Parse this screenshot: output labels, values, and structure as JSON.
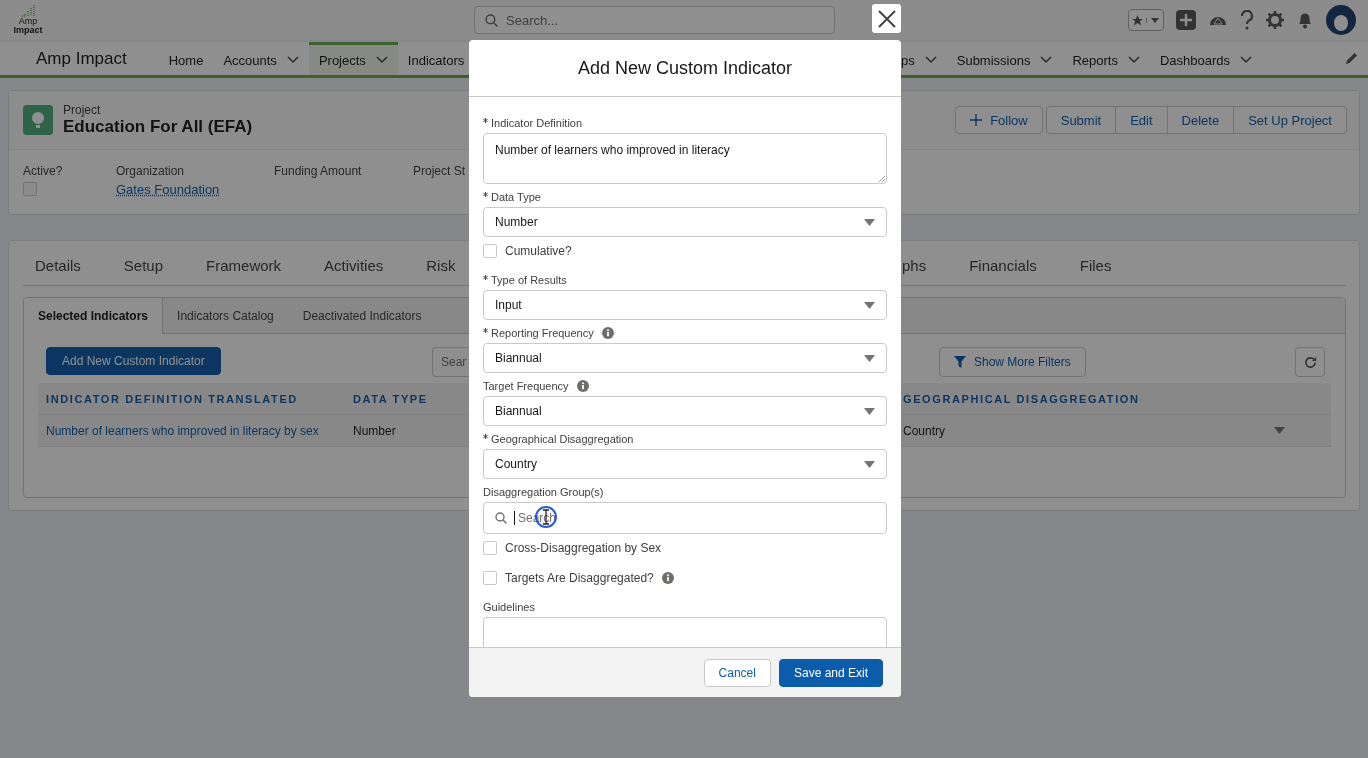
{
  "header": {
    "logo_lines": [
      "Amp",
      "Impact"
    ],
    "search": {
      "placeholder": "Search..."
    }
  },
  "nav": {
    "app_name": "Amp Impact",
    "items_left": [
      {
        "label": "Home",
        "menu": false,
        "selected": false
      },
      {
        "label": "Accounts",
        "menu": true,
        "selected": false
      },
      {
        "label": "Projects",
        "menu": true,
        "selected": true
      },
      {
        "label": "Indicators",
        "menu": false,
        "selected": false
      }
    ],
    "items_right": [
      {
        "label": "ps",
        "menu": true,
        "selected": false
      },
      {
        "label": "Submissions",
        "menu": true,
        "selected": false
      },
      {
        "label": "Reports",
        "menu": true,
        "selected": false
      },
      {
        "label": "Dashboards",
        "menu": true,
        "selected": false
      }
    ]
  },
  "record": {
    "type": "Project",
    "title": "Education For All (EFA)",
    "follow": "Follow",
    "actions": [
      "Submit",
      "Edit",
      "Delete",
      "Set Up Project"
    ],
    "fields": [
      {
        "label": "Active?",
        "kind": "checkbox",
        "checked": false
      },
      {
        "label": "Organization",
        "kind": "link",
        "value": "Gates Foundation"
      },
      {
        "label": "Funding Amount",
        "kind": "text"
      },
      {
        "label": "Project St",
        "kind": "text"
      }
    ]
  },
  "tabs_left": [
    {
      "label": "Details",
      "selected": false
    },
    {
      "label": "Setup",
      "selected": false
    },
    {
      "label": "Framework",
      "selected": false
    },
    {
      "label": "Activities",
      "selected": false
    },
    {
      "label": "Risk",
      "selected": false
    }
  ],
  "tabs_right": [
    {
      "label": "phs",
      "selected": false
    },
    {
      "label": "Financials",
      "selected": false
    },
    {
      "label": "Files",
      "selected": false
    }
  ],
  "subtabs": [
    {
      "label": "Selected Indicators",
      "selected": true
    },
    {
      "label": "Indicators Catalog",
      "selected": false
    },
    {
      "label": "Deactivated Indicators",
      "selected": false
    }
  ],
  "toolbar": {
    "add_button": "Add New Custom Indicator",
    "search_placeholder": "Sear",
    "filters_button": "Show More Filters"
  },
  "table": {
    "columns_left": [
      "INDICATOR DEFINITION TRANSLATED",
      "DATA TYPE"
    ],
    "columns_right": [
      "GEOGRAPHICAL DISAGGREGATION"
    ],
    "rows": [
      {
        "left": [
          "Number of learners who improved in literacy by sex",
          "Number"
        ],
        "right": [
          "Country"
        ]
      }
    ]
  },
  "modal": {
    "title": "Add New Custom Indicator",
    "fields": [
      {
        "kind": "textarea",
        "label": "Indicator Definition",
        "required": true,
        "info": false,
        "value": "Number of learners who improved in literacy"
      },
      {
        "kind": "select",
        "label": "Data Type",
        "required": true,
        "info": false,
        "value": "Number"
      },
      {
        "kind": "checkbox",
        "label": "Cumulative?",
        "checked": false,
        "info": false
      },
      {
        "kind": "select",
        "label": "Type of Results",
        "required": true,
        "info": false,
        "value": "Input"
      },
      {
        "kind": "select",
        "label": "Reporting Frequency",
        "required": true,
        "info": true,
        "value": "Biannual"
      },
      {
        "kind": "select",
        "label": "Target Frequency",
        "required": false,
        "info": true,
        "value": "Biannual"
      },
      {
        "kind": "select",
        "label": "Geographical Disaggregation",
        "required": true,
        "info": false,
        "value": "Country"
      },
      {
        "kind": "lookup",
        "label": "Disaggregation Group(s)",
        "required": false,
        "info": false,
        "placeholder": "Search"
      },
      {
        "kind": "checkbox",
        "label": "Cross-Disaggregation by Sex",
        "checked": false,
        "info": false
      },
      {
        "kind": "checkbox",
        "label": "Targets Are Disaggregated?",
        "checked": false,
        "info": true
      },
      {
        "kind": "textarea",
        "label": "Guidelines",
        "required": false,
        "info": false
      }
    ],
    "buttons": [
      {
        "label": "Cancel",
        "kind": "neutral"
      },
      {
        "label": "Save and Exit",
        "kind": "brand"
      }
    ]
  }
}
